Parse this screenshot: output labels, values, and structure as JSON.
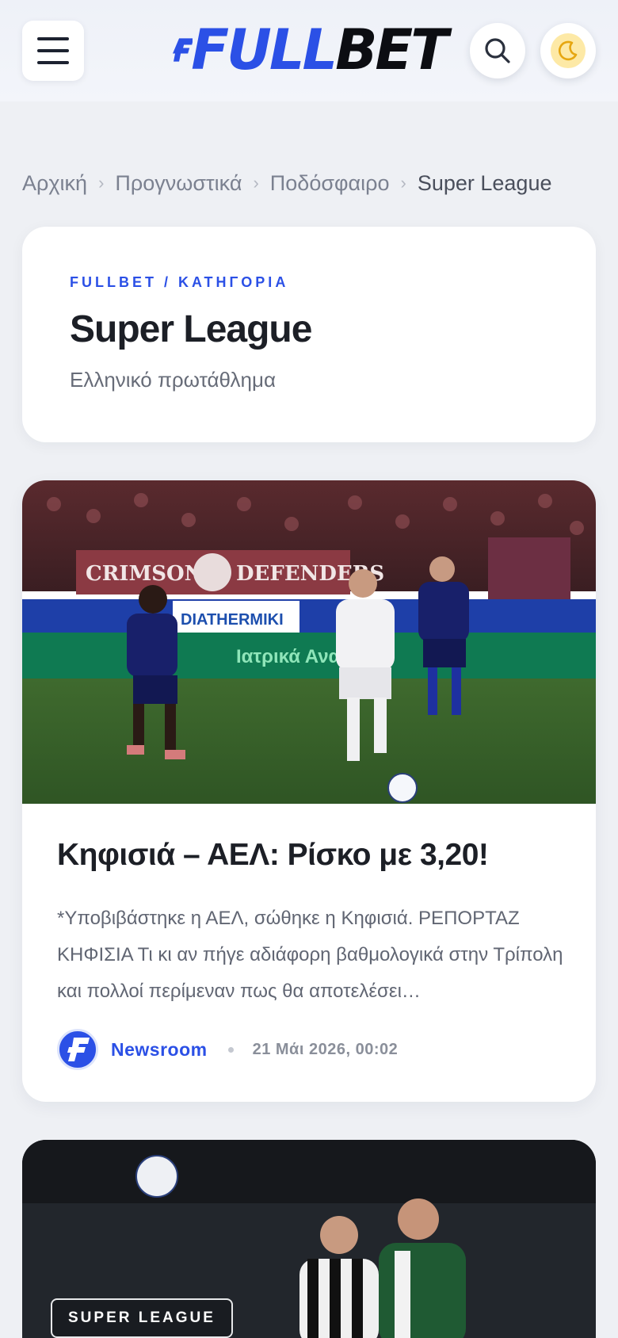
{
  "header": {
    "logo_full": "FULL",
    "logo_bet": "BET",
    "menu_icon": "hamburger-menu-icon",
    "search_icon": "search-icon",
    "theme_icon": "moon-icon"
  },
  "breadcrumb": {
    "items": [
      "Αρχική",
      "Προγνωστικά",
      "Ποδόσφαιρο",
      "Super League"
    ]
  },
  "category": {
    "kicker": "FULLBET / ΚΑΤΗΓΟΡΙΑ",
    "title": "Super League",
    "subtitle": "Ελληνικό πρωτάθλημα"
  },
  "articles": [
    {
      "title": "Κηφισιά – ΑΕΛ: Ρίσκο με 3,20!",
      "excerpt": "*Υποβιβάστηκε η ΑΕΛ, σώθηκε η Κηφισιά. ΡΕΠΟΡΤΑΖ ΚΗΦΙΣΙΑ Τι κι αν πήγε αδιάφορη βαθμολογικά στην Τρίπολη και πολλοί περίμεναν πως θα αποτελέσει…",
      "author": "Newsroom",
      "date": "21 Μάι 2026, 00:02",
      "image_texts": {
        "banner_left": "CRIMSON",
        "banner_right": "DEFENDERS",
        "banner_mid": "DIATHERMIKI",
        "sponsor": "Ιατρικά Αναλ"
      }
    },
    {
      "badge": "SUPER LEAGUE"
    }
  ],
  "colors": {
    "accent": "#2b50e6",
    "background": "#eef0f4",
    "card": "#ffffff"
  }
}
